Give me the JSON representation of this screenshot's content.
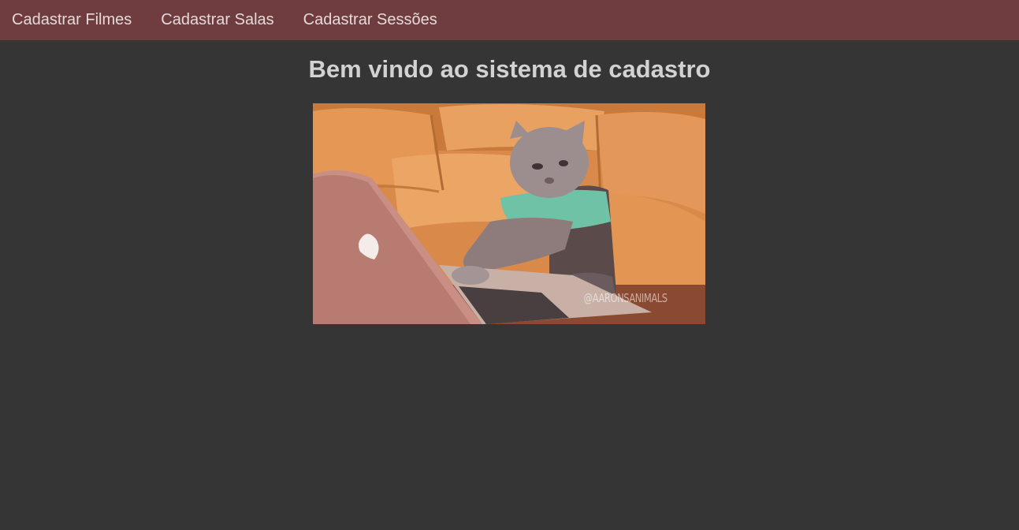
{
  "nav": {
    "items": [
      {
        "label": "Cadastrar Filmes"
      },
      {
        "label": "Cadastrar Salas"
      },
      {
        "label": "Cadastrar Sessões"
      }
    ]
  },
  "main": {
    "title": "Bem vindo ao sistema de cadastro",
    "image": {
      "watermark": "@AARONSANIMALS"
    }
  },
  "colors": {
    "navbar_bg": "#6f3d3f",
    "page_bg": "#353535",
    "nav_text": "#e6d9d9",
    "title_text": "#d2d2d2"
  }
}
